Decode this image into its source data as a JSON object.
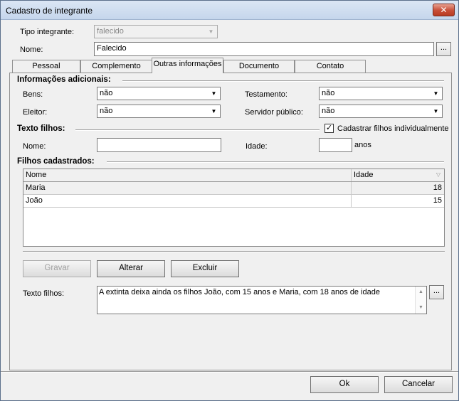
{
  "window": {
    "title": "Cadastro de integrante",
    "close_label": "✕"
  },
  "header": {
    "tipo_label": "Tipo integrante:",
    "tipo_value": "falecido",
    "nome_label": "Nome:",
    "nome_value": "Falecido",
    "ellipsis": "..."
  },
  "tabs": [
    "Pessoal",
    "Complemento",
    "Outras informações",
    "Documento",
    "Contato"
  ],
  "adicionais": {
    "title": "Informações adicionais:",
    "bens_label": "Bens:",
    "bens_value": "não",
    "testamento_label": "Testamento:",
    "testamento_value": "não",
    "eleitor_label": "Eleitor:",
    "eleitor_value": "não",
    "servidor_label": "Servidor público:",
    "servidor_value": "não"
  },
  "texto_filhos_section": {
    "title": "Texto filhos:",
    "checkbox_label": "Cadastrar filhos individualmente",
    "checkbox_mark": "✓",
    "nome_label": "Nome:",
    "nome_value": "",
    "idade_label": "Idade:",
    "idade_value": "",
    "anos_label": "anos"
  },
  "filhos": {
    "title": "Filhos cadastrados:",
    "columns": [
      "Nome",
      "Idade"
    ],
    "rows": [
      {
        "nome": "Maria",
        "idade": "18"
      },
      {
        "nome": "João",
        "idade": "15"
      }
    ]
  },
  "actions": {
    "gravar": "Gravar",
    "alterar": "Alterar",
    "excluir": "Excluir"
  },
  "texto": {
    "label": "Texto filhos:",
    "value": "A extinta deixa ainda os filhos João, com 15 anos e Maria, com 18 anos de idade",
    "scroll_up": "▲",
    "scroll_down": "▼"
  },
  "footer": {
    "ok": "Ok",
    "cancelar": "Cancelar"
  }
}
